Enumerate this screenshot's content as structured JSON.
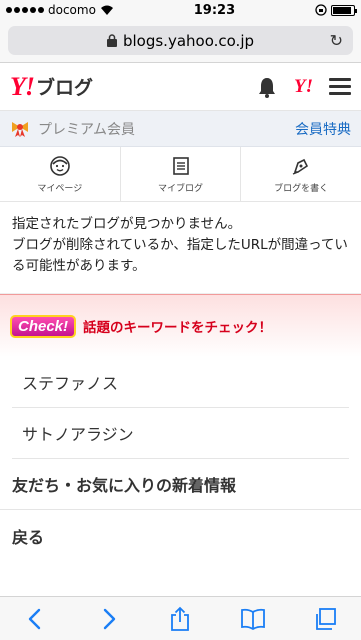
{
  "status_bar": {
    "carrier": "docomo",
    "time": "19:23"
  },
  "url_bar": {
    "url": "blogs.yahoo.co.jp"
  },
  "header": {
    "logo_mark": "Y!",
    "logo_text": "ブログ",
    "yahoo_badge": "Y!"
  },
  "premium": {
    "label": "プレミアム会員",
    "link": "会員特典"
  },
  "nav": {
    "items": [
      {
        "label": "マイページ",
        "icon": "face-icon"
      },
      {
        "label": "マイブログ",
        "icon": "document-icon"
      },
      {
        "label": "ブログを書く",
        "icon": "pen-icon"
      }
    ]
  },
  "error": {
    "line1": "指定されたブログが見つかりません。",
    "line2": "ブログが削除されているか、指定したURLが間違っている可能性があります。"
  },
  "check": {
    "badge": "Check!",
    "title": "話題のキーワードをチェック！",
    "keywords": [
      "ステファノス",
      "サトノアラジン"
    ]
  },
  "links": {
    "friends": "友だち・お気に入りの新着情報",
    "back": "戻る"
  },
  "colors": {
    "yahoo_red": "#ff0033",
    "link_blue": "#1a6cc4",
    "check_red": "#d6001c",
    "toolbar_blue": "#1a7ef5"
  }
}
